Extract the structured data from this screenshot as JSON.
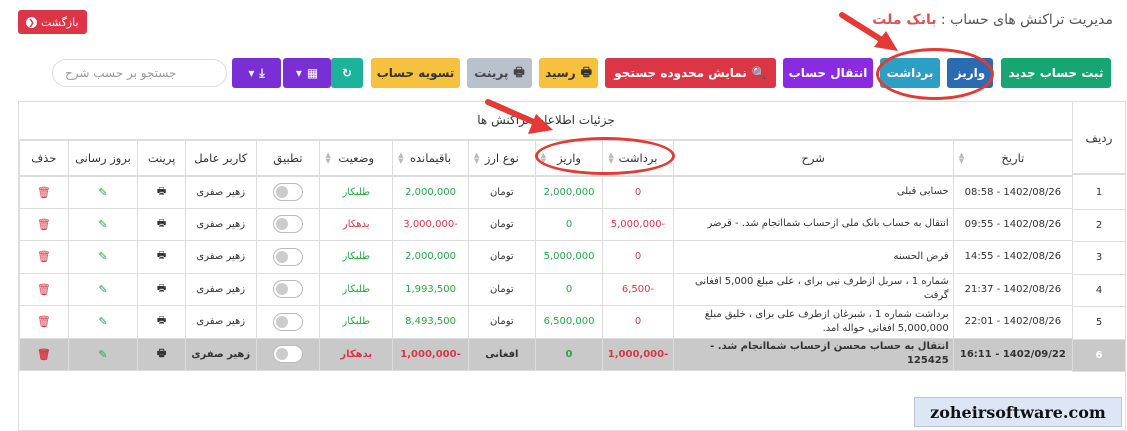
{
  "header": {
    "title_prefix": "مدیریت تراکنش های حساب :",
    "bank_name": "بانک ملت",
    "back_label": "بازگشت"
  },
  "toolbar": {
    "new_account": "ثبت حساب جدید",
    "deposit": "واریز",
    "withdraw": "برداشت",
    "transfer": "انتقال حساب",
    "search_range": "نمایش محدوده جستجو",
    "receipt": "رسید",
    "print": "پرینت",
    "settle": "تسویه حساب"
  },
  "search": {
    "placeholder": "جستجو بر حسب شرح"
  },
  "table": {
    "group_title": "جزئیات اطلاعات تراکنش ها",
    "radif_header": "ردیف",
    "headers": [
      "تاریخ",
      "شرح",
      "برداشت",
      "واریز",
      "نوع ارز",
      "باقیمانده",
      "وضعیت",
      "تطبیق",
      "کاربر عامل",
      "پرینت",
      "بروز رسانی",
      "حذف"
    ],
    "rows": [
      {
        "radif": "1",
        "date": "1402/08/26 - 08:58",
        "desc": "حسابی قبلی",
        "withdraw": "0",
        "deposit": "2,000,000",
        "currency": "تومان",
        "balance": "2,000,000",
        "status": "طلبکار",
        "user": "زهیر صفری"
      },
      {
        "radif": "2",
        "date": "1402/08/26 - 09:55",
        "desc": "انتقال به حساب بانک ملی ازحساب شماانجام شد. - قرضر",
        "withdraw": "-5,000,000",
        "deposit": "0",
        "currency": "تومان",
        "balance": "-3,000,000",
        "status": "بدهکار",
        "user": "زهیر صفری"
      },
      {
        "radif": "3",
        "date": "1402/08/26 - 14:55",
        "desc": "قرض الحسنه",
        "withdraw": "0",
        "deposit": "5,000,000",
        "currency": "تومان",
        "balance": "2,000,000",
        "status": "طلبکار",
        "user": "زهیر صفری"
      },
      {
        "radif": "4",
        "date": "1402/08/26 - 21:37",
        "desc": "شماره 1 ، سربل ازطرف نبی برای ، علی مبلغ 5,000 افغانی گرفت",
        "withdraw": "-6,500",
        "deposit": "0",
        "currency": "تومان",
        "balance": "1,993,500",
        "status": "طلبکار",
        "user": "زهیر صفری"
      },
      {
        "radif": "5",
        "date": "1402/08/26 - 22:01",
        "desc": "برداشت شماره 1 ، شبرغان ازطرف علی برای ، خلیق مبلغ 5,000,000 افغانی حواله امد.",
        "withdraw": "0",
        "deposit": "6,500,000",
        "currency": "تومان",
        "balance": "8,493,500",
        "status": "طلبکار",
        "user": "زهیر صفری"
      },
      {
        "radif": "6",
        "date": "1402/09/22 - 16:11",
        "desc": "انتقال به حساب محسن ازحساب شماانجام شد. - 125425",
        "withdraw": "-1,000,000",
        "deposit": "0",
        "currency": "افغانی",
        "balance": "-1,000,000",
        "status": "بدهکار",
        "user": "زهیر صفری"
      }
    ]
  },
  "watermark": "zoheirsoftware.com",
  "colors": {
    "positive": "#28a745",
    "negative": "#dc3545",
    "annotation": "#e53935"
  }
}
